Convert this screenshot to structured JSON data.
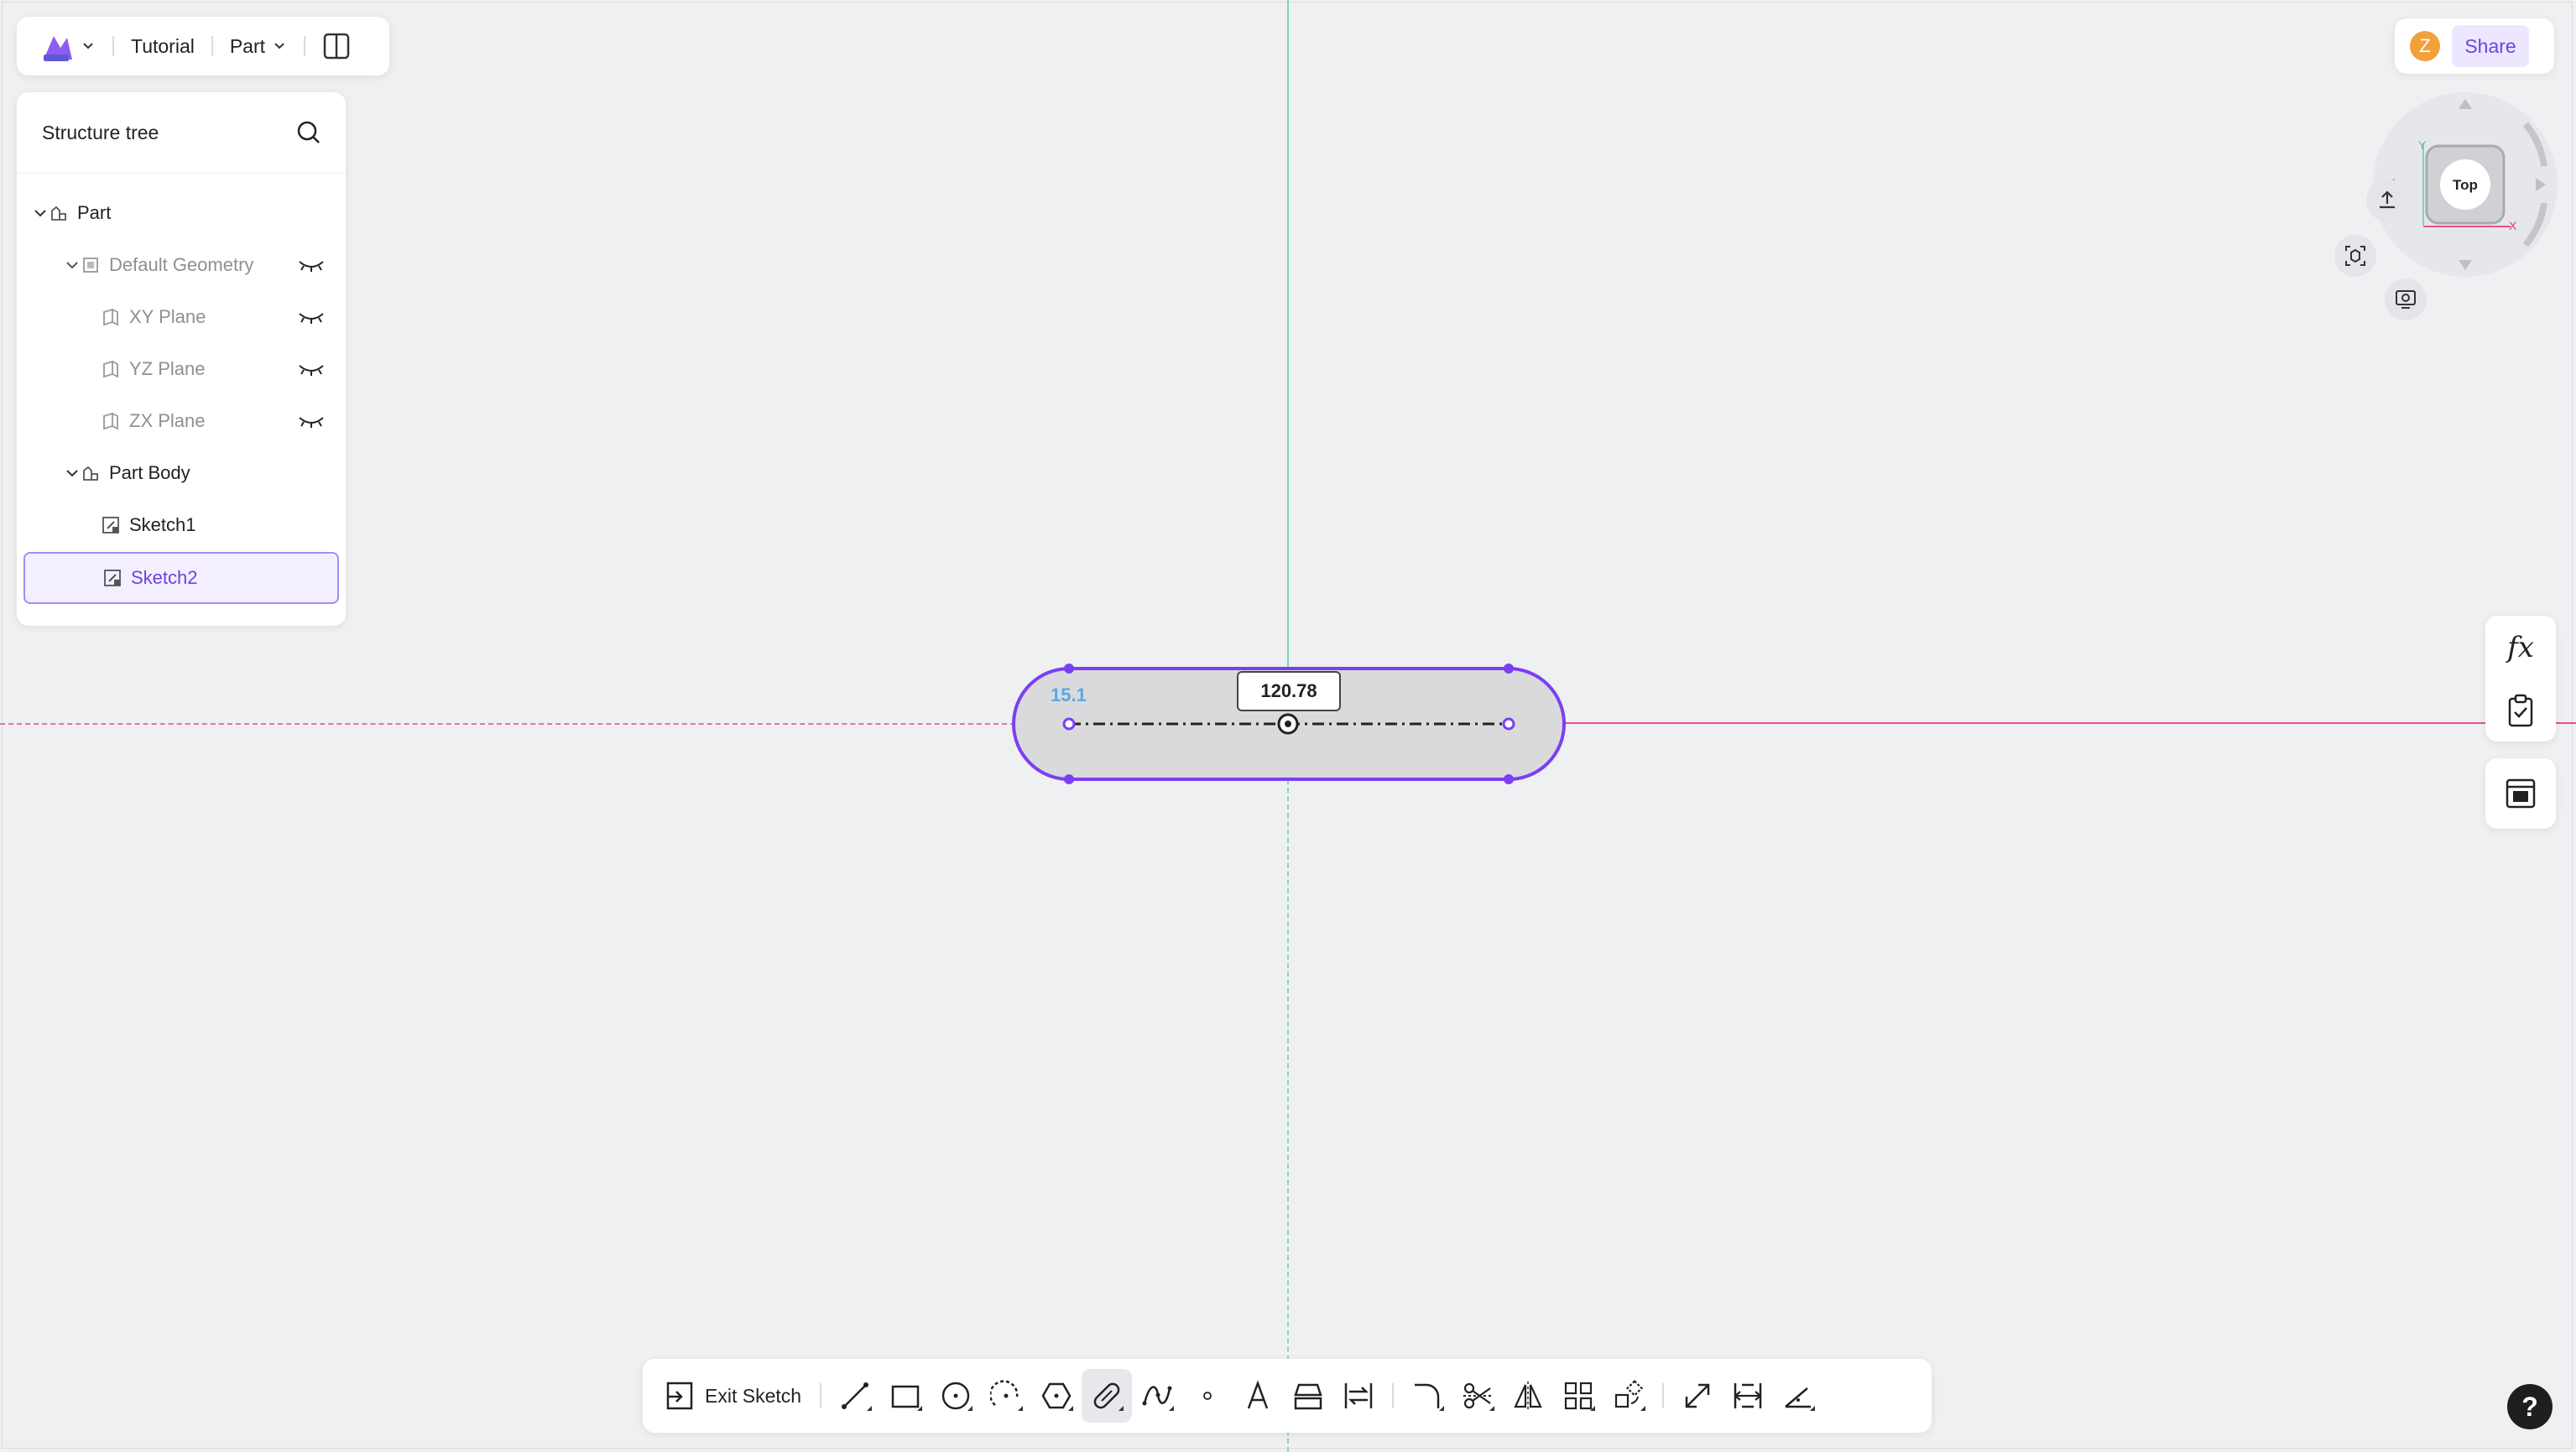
{
  "header": {
    "project": "Tutorial",
    "mode": "Part"
  },
  "tree": {
    "title": "Structure tree",
    "items": [
      {
        "label": "Part"
      },
      {
        "label": "Default Geometry"
      },
      {
        "label": "XY Plane"
      },
      {
        "label": "YZ Plane"
      },
      {
        "label": "ZX Plane"
      },
      {
        "label": "Part Body"
      },
      {
        "label": "Sketch1"
      },
      {
        "label": "Sketch2"
      }
    ]
  },
  "user": {
    "initial": "Z"
  },
  "share_label": "Share",
  "viewcube": {
    "face": "Top",
    "axis_y": "Y",
    "axis_x": "X"
  },
  "side_tools": {
    "formula": "fx"
  },
  "sketch": {
    "dim_length": "120.78",
    "dim_radius": "15.1"
  },
  "toolbar": {
    "exit_label": "Exit Sketch"
  },
  "help_label": "?",
  "colors": {
    "accent": "#7b3ff2",
    "axis_x": "#ee4f8f",
    "axis_y": "#7fd3b8",
    "canvas": "#eff0f2"
  }
}
